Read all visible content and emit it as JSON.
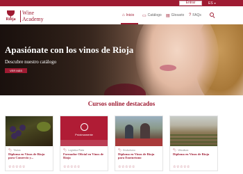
{
  "topbar": {
    "enter_label": "Entrar",
    "lang_label": "ES"
  },
  "header": {
    "logo_text": "Rioja",
    "brand_line1": "Wine",
    "brand_line2": "Academy",
    "nav": [
      {
        "label": "Inicio",
        "icon": "home-icon",
        "active": true
      },
      {
        "label": "Catálogo",
        "icon": "catalog-icon",
        "active": false
      },
      {
        "label": "Glosario",
        "icon": "glossary-icon",
        "active": false
      },
      {
        "label": "FAQs",
        "icon": "faq-icon",
        "active": false
      }
    ]
  },
  "hero": {
    "title": "Apasiónate con los vinos de Rioja",
    "subtitle": "Descubre nuestro catálogo",
    "button_label": "VER MÁS"
  },
  "featured": {
    "title": "Cursos online destacados",
    "cards": [
      {
        "category": "Títulos",
        "title": "Diploma en Vinos de Rioja para Comercio y...",
        "stars": "☆☆☆☆☆"
      },
      {
        "category": "Logística Plata",
        "title": "Formador Oficial en Vinos de Rioja",
        "image_text": "Próximamente",
        "stars": "☆☆☆☆☆"
      },
      {
        "category": "Enoturismo",
        "title": "Diploma en Vinos de Rioja para Enoturismo",
        "stars": "☆☆☆☆☆"
      },
      {
        "category": "Viticultura",
        "title": "Diploma en Vinos de Rioja",
        "stars": "☆☆☆☆☆"
      }
    ]
  },
  "colors": {
    "brand": "#9e1b32",
    "background": "#ffffff"
  }
}
